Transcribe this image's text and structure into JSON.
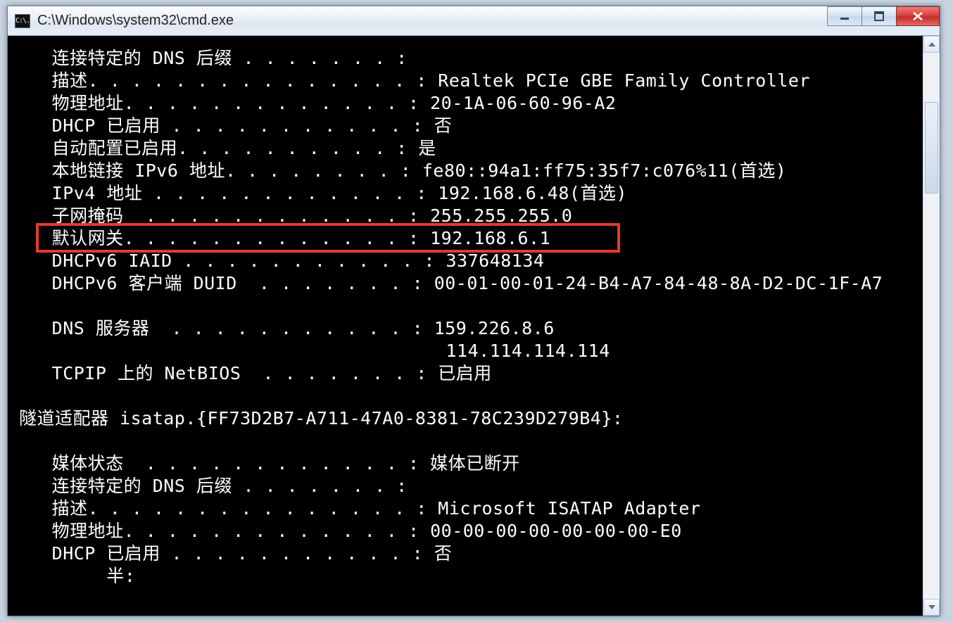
{
  "window": {
    "title": "C:\\Windows\\system32\\cmd.exe",
    "app_icon_text": "C:\\."
  },
  "terminal": {
    "lines": [
      "   连接特定的 DNS 后缀 . . . . . . . :",
      "   描述. . . . . . . . . . . . . . . : Realtek PCIe GBE Family Controller",
      "   物理地址. . . . . . . . . . . . . : 20-1A-06-60-96-A2",
      "   DHCP 已启用 . . . . . . . . . . . : 否",
      "   自动配置已启用. . . . . . . . . . : 是",
      "   本地链接 IPv6 地址. . . . . . . . : fe80::94a1:ff75:35f7:c076%11(首选)",
      "   IPv4 地址 . . . . . . . . . . . . : 192.168.6.48(首选)",
      "   子网掩码  . . . . . . . . . . . . : 255.255.255.0",
      "   默认网关. . . . . . . . . . . . . : 192.168.6.1",
      "   DHCPv6 IAID . . . . . . . . . . . : 337648134",
      "   DHCPv6 客户端 DUID  . . . . . . . : 00-01-00-01-24-B4-A7-84-48-8A-D2-DC-1F-A7",
      "",
      "   DNS 服务器  . . . . . . . . . . . : 159.226.8.6",
      "                                       114.114.114.114",
      "   TCPIP 上的 NetBIOS  . . . . . . . : 已启用",
      "",
      "隧道适配器 isatap.{FF73D2B7-A711-47A0-8381-78C239D279B4}:",
      "",
      "   媒体状态  . . . . . . . . . . . . : 媒体已断开",
      "   连接特定的 DNS 后缀 . . . . . . . :",
      "   描述. . . . . . . . . . . . . . . : Microsoft ISATAP Adapter",
      "   物理地址. . . . . . . . . . . . . : 00-00-00-00-00-00-00-E0",
      "   DHCP 已启用 . . . . . . . . . . . : 否",
      "        半:"
    ],
    "highlight_line_index": 8
  }
}
